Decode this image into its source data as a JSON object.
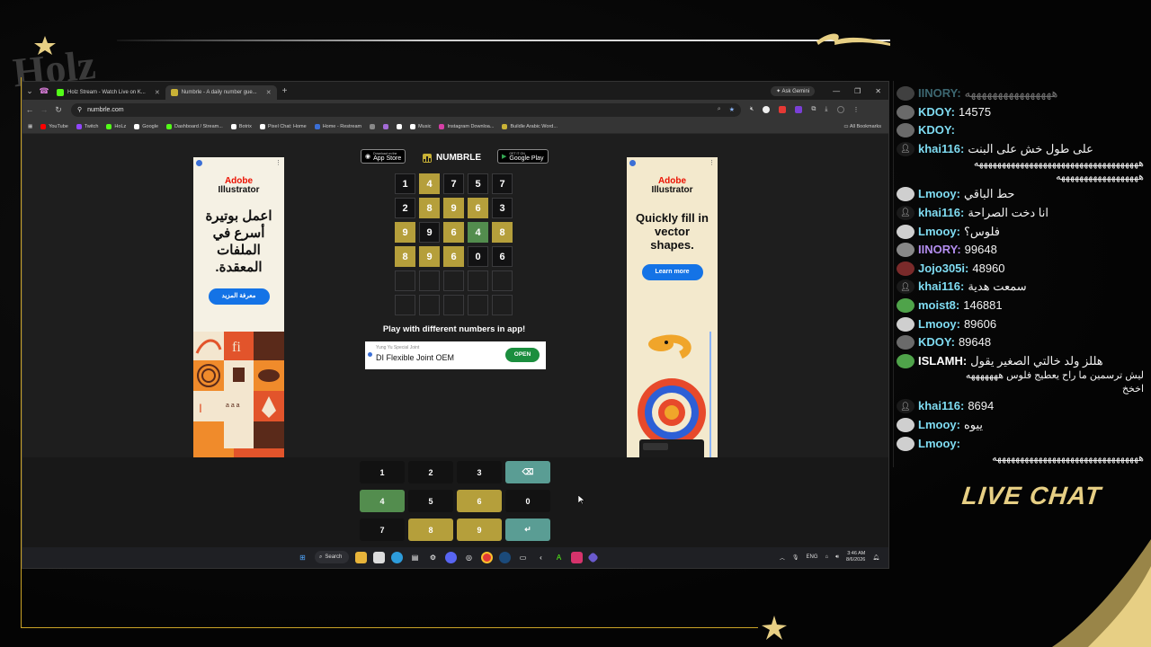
{
  "overlay": {
    "logo_text": "Holz",
    "live_chat_title": "LIVE CHAT",
    "colors": {
      "gold": "#c9a227",
      "gold_light": "#e7cf84"
    }
  },
  "browser": {
    "tabs": [
      {
        "label": "Holz Stream - Watch Live on K...",
        "icon_color": "#53fc18",
        "active": false
      },
      {
        "label": "Numbrle - A daily number gue...",
        "icon_color": "#c9b236",
        "active": true
      }
    ],
    "gemini_label": "Ask Gemini",
    "url": "numbrle.com",
    "bookmarks": [
      {
        "label": "YouTube",
        "color": "#ff0000"
      },
      {
        "label": "Twitch",
        "color": "#9146ff"
      },
      {
        "label": "HoLz",
        "color": "#53fc18"
      },
      {
        "label": "Google",
        "color": "#ffffff"
      },
      {
        "label": "Dashboard / Stream...",
        "color": "#53fc18"
      },
      {
        "label": "Botrix",
        "color": "#ffffff"
      },
      {
        "label": "Pixel Chat: Home",
        "color": "#ffffff"
      },
      {
        "label": "Home - Restream",
        "color": "#3b6fd6"
      },
      {
        "label": "",
        "color": "#888888"
      },
      {
        "label": "",
        "color": "#a36bd6"
      },
      {
        "label": "",
        "color": "#ffffff"
      },
      {
        "label": "Music",
        "color": "#ffffff"
      },
      {
        "label": "Instagram Downloa...",
        "color": "#d63fa6"
      },
      {
        "label": "Buildle Arabic Word...",
        "color": "#c9b236"
      }
    ],
    "all_bookmarks": "All Bookmarks"
  },
  "ads": {
    "left": {
      "brand_top": "Adobe",
      "brand_bottom": "Illustrator",
      "headline": "اعمل بوتيرة أسرع في الملفات المعقدة.",
      "button": "معرفة المزيد"
    },
    "right": {
      "brand_top": "Adobe",
      "brand_bottom": "Illustrator",
      "headline": "Quickly fill in vector shapes.",
      "button": "Learn more"
    }
  },
  "numbrle": {
    "brand": "NUMBRLE",
    "app_store": {
      "small": "Download on the",
      "label": "App Store"
    },
    "google_play": {
      "small": "GET IT ON",
      "label": "Google Play"
    },
    "grid": [
      [
        {
          "v": "1",
          "s": "absent"
        },
        {
          "v": "4",
          "s": "present"
        },
        {
          "v": "7",
          "s": "absent"
        },
        {
          "v": "5",
          "s": "absent"
        },
        {
          "v": "7",
          "s": "absent"
        }
      ],
      [
        {
          "v": "2",
          "s": "absent"
        },
        {
          "v": "8",
          "s": "present"
        },
        {
          "v": "9",
          "s": "present"
        },
        {
          "v": "6",
          "s": "present"
        },
        {
          "v": "3",
          "s": "absent"
        }
      ],
      [
        {
          "v": "9",
          "s": "present"
        },
        {
          "v": "9",
          "s": "absent"
        },
        {
          "v": "6",
          "s": "present"
        },
        {
          "v": "4",
          "s": "correct"
        },
        {
          "v": "8",
          "s": "present"
        }
      ],
      [
        {
          "v": "8",
          "s": "present"
        },
        {
          "v": "9",
          "s": "present"
        },
        {
          "v": "6",
          "s": "present"
        },
        {
          "v": "0",
          "s": "absent"
        },
        {
          "v": "6",
          "s": "absent"
        }
      ],
      [
        {
          "v": "",
          "s": "empty"
        },
        {
          "v": "",
          "s": "empty"
        },
        {
          "v": "",
          "s": "empty"
        },
        {
          "v": "",
          "s": "empty"
        },
        {
          "v": "",
          "s": "empty"
        }
      ],
      [
        {
          "v": "",
          "s": "empty"
        },
        {
          "v": "",
          "s": "empty"
        },
        {
          "v": "",
          "s": "empty"
        },
        {
          "v": "",
          "s": "empty"
        },
        {
          "v": "",
          "s": "empty"
        }
      ]
    ],
    "play_text": "Play with different numbers in app!",
    "banner": {
      "small": "Yung Yu Special Joint",
      "title": "DI Flexible Joint OEM",
      "button": "OPEN"
    },
    "keypad": [
      {
        "label": "1",
        "s": "absent",
        "name": "key-1"
      },
      {
        "label": "2",
        "s": "absent",
        "name": "key-2"
      },
      {
        "label": "3",
        "s": "absent",
        "name": "key-3"
      },
      {
        "label": "⌫",
        "s": "action",
        "name": "backspace-key"
      },
      {
        "label": "4",
        "s": "correct",
        "name": "key-4"
      },
      {
        "label": "5",
        "s": "absent",
        "name": "key-5"
      },
      {
        "label": "6",
        "s": "present",
        "name": "key-6"
      },
      {
        "label": "0",
        "s": "absent",
        "name": "key-0"
      },
      {
        "label": "7",
        "s": "absent",
        "name": "key-7"
      },
      {
        "label": "8",
        "s": "present",
        "name": "key-8"
      },
      {
        "label": "9",
        "s": "present",
        "name": "key-9"
      },
      {
        "label": "↵",
        "s": "action",
        "name": "enter-key"
      }
    ],
    "colors": {
      "present": "#b59f3b",
      "correct": "#538d4e",
      "action": "#5a9d94"
    }
  },
  "taskbar": {
    "search": "Search",
    "lang": "ENG",
    "time": "3:46 AM",
    "date": "8/6/2026"
  },
  "chat": [
    {
      "user": "IINORY:",
      "msg": "ههههههههههههههههه",
      "color": "#7fdcf2",
      "avatar": "#888888",
      "faded": true
    },
    {
      "user": "KDOY:",
      "msg": "14575",
      "color": "#7fdcf2",
      "avatar": "#6a6a6a"
    },
    {
      "user": "KDOY:",
      "msg": "",
      "color": "#7fdcf2",
      "avatar": "#6a6a6a"
    },
    {
      "user": "khai116:",
      "msg": "على طول خش على البنت",
      "color": "#7fdcf2",
      "avatar": "#1a1a1a"
    },
    {
      "wrap": "ههههههههههههههههههههههههههههههههههههه"
    },
    {
      "wrap": "ههههههههههههههههههه"
    },
    {
      "user": "Lmooy:",
      "msg": "حط الباقي",
      "color": "#7fdcf2",
      "avatar": "#cfcfcf"
    },
    {
      "user": "khai116:",
      "msg": "انا دخت الصراحة",
      "color": "#7fdcf2",
      "avatar": "#1a1a1a"
    },
    {
      "user": "Lmooy:",
      "msg": "فلوس؟",
      "color": "#7fdcf2",
      "avatar": "#cfcfcf"
    },
    {
      "user": "IINORY:",
      "msg": "99648",
      "color": "#b48ef0",
      "avatar": "#888888"
    },
    {
      "user": "Jojo305i:",
      "msg": "48960",
      "color": "#7fdcf2",
      "avatar": "#7a2a2a"
    },
    {
      "user": "khai116:",
      "msg": "سمعت هدية",
      "color": "#7fdcf2",
      "avatar": "#1a1a1a"
    },
    {
      "user": "moist8:",
      "msg": "146881",
      "color": "#7fdcf2",
      "avatar": "#4fa34a"
    },
    {
      "user": "Lmooy:",
      "msg": "89606",
      "color": "#7fdcf2",
      "avatar": "#cfcfcf"
    },
    {
      "user": "KDOY:",
      "msg": "89648",
      "color": "#7fdcf2",
      "avatar": "#6a6a6a"
    },
    {
      "user": "ISLAMH:",
      "msg": "هللز ولد خالتي الصغير يقول",
      "color": "#ffffff",
      "avatar": "#4fa34a"
    },
    {
      "wrap": "ليش ترسمين ما راح يعطيج فلوس هههههههه"
    },
    {
      "wrap": "اخخخ"
    },
    {
      "user": "khai116:",
      "msg": "8694",
      "color": "#7fdcf2",
      "avatar": "#1a1a1a"
    },
    {
      "user": "Lmooy:",
      "msg": "ييوه",
      "color": "#7fdcf2",
      "avatar": "#cfcfcf"
    },
    {
      "user": "Lmooy:",
      "msg": "",
      "color": "#7fdcf2",
      "avatar": "#cfcfcf"
    },
    {
      "wrap": "ههههههههههههههههههههههههههههههههه"
    }
  ]
}
